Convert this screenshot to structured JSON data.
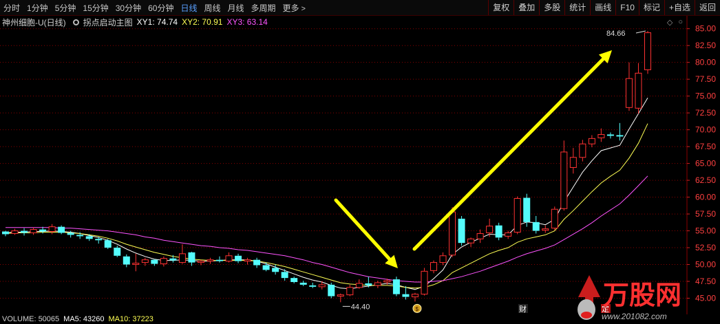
{
  "toolbar": {
    "periods": [
      "分时",
      "1分钟",
      "5分钟",
      "15分钟",
      "30分钟",
      "60分钟",
      "日线",
      "周线",
      "月线",
      "多周期",
      "更多"
    ],
    "active_period": "日线",
    "tools": [
      "复权",
      "叠加",
      "多股",
      "统计",
      "画线",
      "F10",
      "标记",
      "+自选",
      "返回"
    ]
  },
  "info": {
    "stock": "神州细胞-U(日线)",
    "indicator": "拐点启动主图",
    "xy1": "XY1: 74.74",
    "xy2": "XY2: 70.91",
    "xy3": "XY3: 63.14"
  },
  "volume": {
    "vol": "VOLUME: 50065",
    "ma5": "MA5: 43260",
    "ma10": "MA10: 37223"
  },
  "markers": {
    "cai": "财",
    "ding": "定"
  },
  "watermark": {
    "brand": "万股网",
    "url": "www.201082.com"
  },
  "chart_data": {
    "type": "candlestick",
    "y_ticks": [
      "85.00",
      "82.50",
      "80.00",
      "77.50",
      "75.00",
      "72.50",
      "70.00",
      "67.50",
      "65.00",
      "62.50",
      "60.00",
      "57.50",
      "55.00",
      "52.50",
      "50.00",
      "47.50",
      "45.00"
    ],
    "ylim": [
      43.5,
      85.5
    ],
    "high_label": "84.66",
    "low_label": "44.40",
    "grid": true,
    "colors": {
      "up": "#ff3232",
      "down": "#54fcfc",
      "line_xy1": "#ffffff",
      "line_xy2": "#ffff54",
      "line_xy3": "#ff54ff",
      "arrow": "#ffff00",
      "grid": "#8b0000",
      "axis_text": "#ff4040"
    },
    "candles": [
      [
        54.9,
        55.0,
        54.2,
        54.5
      ],
      [
        54.6,
        55.3,
        54.4,
        55.0
      ],
      [
        55.0,
        55.4,
        54.3,
        54.7
      ],
      [
        54.7,
        55.5,
        54.4,
        55.2
      ],
      [
        55.2,
        55.6,
        54.6,
        54.9
      ],
      [
        54.9,
        56.0,
        54.5,
        55.6
      ],
      [
        55.6,
        55.8,
        54.5,
        54.7
      ],
      [
        54.7,
        55.0,
        54.0,
        54.4
      ],
      [
        54.4,
        54.8,
        53.8,
        54.2
      ],
      [
        54.2,
        54.5,
        53.5,
        53.8
      ],
      [
        53.8,
        54.1,
        53.1,
        53.6
      ],
      [
        53.6,
        53.8,
        52.3,
        52.5
      ],
      [
        52.5,
        52.8,
        51.1,
        51.3
      ],
      [
        51.2,
        51.5,
        49.6,
        50.0
      ],
      [
        50.0,
        51.6,
        49.0,
        50.2
      ],
      [
        50.3,
        51.0,
        49.8,
        50.7
      ],
      [
        50.7,
        50.8,
        49.8,
        50.1
      ],
      [
        50.1,
        51.2,
        49.7,
        50.9
      ],
      [
        50.9,
        51.4,
        50.3,
        50.6
      ],
      [
        50.3,
        53.0,
        50.1,
        51.6
      ],
      [
        51.8,
        51.9,
        49.8,
        50.3
      ],
      [
        50.3,
        50.7,
        49.9,
        50.5
      ],
      [
        50.5,
        51.0,
        50.1,
        50.7
      ],
      [
        50.7,
        51.2,
        50.3,
        50.5
      ],
      [
        50.5,
        51.8,
        50.3,
        51.3
      ],
      [
        51.3,
        51.6,
        50.2,
        50.5
      ],
      [
        50.5,
        51.0,
        50.0,
        50.7
      ],
      [
        50.7,
        51.0,
        49.5,
        49.9
      ],
      [
        49.9,
        50.3,
        49.0,
        49.2
      ],
      [
        49.5,
        50.0,
        48.5,
        48.9
      ],
      [
        48.9,
        49.3,
        47.6,
        48.0
      ],
      [
        48.0,
        48.2,
        47.2,
        47.4
      ],
      [
        47.3,
        47.6,
        46.8,
        47.0
      ],
      [
        46.9,
        47.3,
        46.5,
        46.7
      ],
      [
        46.7,
        47.5,
        46.3,
        47.0
      ],
      [
        47.0,
        47.3,
        45.0,
        45.3
      ],
      [
        45.3,
        45.7,
        44.4,
        45.5
      ],
      [
        45.5,
        47.0,
        45.3,
        46.6
      ],
      [
        46.6,
        47.8,
        46.4,
        47.2
      ],
      [
        47.2,
        48.2,
        46.6,
        46.9
      ],
      [
        46.9,
        47.6,
        46.5,
        47.3
      ],
      [
        47.4,
        47.9,
        47.0,
        47.6
      ],
      [
        47.8,
        48.2,
        45.3,
        45.6
      ],
      [
        45.6,
        46.8,
        44.8,
        45.2
      ],
      [
        45.2,
        45.8,
        44.5,
        45.6
      ],
      [
        45.6,
        49.5,
        45.4,
        49.0
      ],
      [
        49.1,
        50.6,
        48.7,
        50.3
      ],
      [
        50.3,
        51.8,
        49.9,
        51.3
      ],
      [
        51.4,
        58.5,
        51.1,
        57.8
      ],
      [
        56.8,
        57.2,
        52.8,
        53.2
      ],
      [
        53.2,
        54.0,
        52.6,
        53.8
      ],
      [
        53.8,
        55.2,
        53.2,
        54.6
      ],
      [
        54.7,
        56.8,
        54.1,
        55.7
      ],
      [
        55.8,
        56.2,
        53.6,
        54.0
      ],
      [
        54.2,
        55.0,
        53.8,
        54.7
      ],
      [
        54.8,
        60.1,
        54.5,
        59.8
      ],
      [
        59.9,
        60.5,
        55.6,
        56.3
      ],
      [
        56.3,
        57.2,
        54.6,
        55.0
      ],
      [
        55.1,
        55.8,
        54.7,
        55.3
      ],
      [
        55.4,
        58.6,
        55.1,
        58.2
      ],
      [
        58.3,
        68.4,
        58.0,
        66.7
      ],
      [
        64.4,
        67.3,
        63.5,
        65.9
      ],
      [
        65.9,
        68.5,
        65.3,
        67.9
      ],
      [
        67.9,
        69.2,
        67.4,
        68.7
      ],
      [
        68.8,
        70.2,
        68.2,
        69.3
      ],
      [
        69.3,
        69.6,
        68.7,
        69.1
      ],
      [
        69.2,
        71.0,
        68.4,
        69.0
      ],
      [
        73.3,
        80.0,
        72.8,
        77.6
      ],
      [
        73.2,
        79.9,
        72.4,
        78.4
      ],
      [
        78.9,
        84.66,
        78.3,
        84.4
      ]
    ],
    "series": [
      {
        "name": "XY1",
        "values": [
          54.7,
          54.8,
          54.8,
          54.9,
          54.9,
          55.0,
          54.9,
          54.8,
          54.6,
          54.3,
          54.0,
          53.6,
          53.0,
          52.3,
          51.7,
          51.2,
          50.8,
          50.6,
          50.6,
          50.7,
          50.6,
          50.5,
          50.5,
          50.6,
          50.7,
          50.7,
          50.7,
          50.5,
          50.1,
          49.6,
          49.1,
          48.6,
          48.1,
          47.7,
          47.4,
          46.9,
          46.5,
          46.4,
          46.6,
          46.8,
          47.0,
          47.2,
          47.0,
          46.6,
          46.3,
          46.8,
          47.9,
          49.2,
          51.5,
          52.6,
          53.3,
          53.9,
          54.5,
          54.4,
          54.4,
          55.8,
          56.3,
          56.2,
          55.9,
          56.7,
          59.3,
          61.5,
          63.7,
          65.4,
          66.9,
          67.3,
          67.7,
          70.1,
          72.4,
          74.74
        ]
      },
      {
        "name": "XY2",
        "values": [
          54.6,
          54.7,
          54.7,
          54.7,
          54.8,
          54.8,
          54.8,
          54.7,
          54.6,
          54.4,
          54.2,
          53.9,
          53.5,
          53.0,
          52.6,
          52.2,
          51.8,
          51.5,
          51.2,
          51.0,
          50.8,
          50.7,
          50.6,
          50.6,
          50.6,
          50.6,
          50.6,
          50.5,
          50.3,
          50.0,
          49.7,
          49.3,
          48.9,
          48.5,
          48.1,
          47.7,
          47.3,
          47.1,
          47.0,
          46.9,
          46.9,
          46.9,
          46.8,
          46.6,
          46.5,
          46.6,
          47.0,
          47.6,
          48.8,
          49.5,
          50.2,
          50.9,
          51.6,
          52.1,
          52.5,
          53.3,
          53.8,
          54.1,
          54.4,
          55.0,
          56.7,
          58.0,
          59.4,
          60.8,
          62.1,
          63.1,
          64.0,
          65.8,
          68.0,
          70.91
        ]
      },
      {
        "name": "XY3",
        "values": [
          55.5,
          55.5,
          55.5,
          55.5,
          55.5,
          55.5,
          55.4,
          55.4,
          55.3,
          55.2,
          55.1,
          55.0,
          54.8,
          54.6,
          54.4,
          54.1,
          53.9,
          53.6,
          53.4,
          53.2,
          53.0,
          52.8,
          52.7,
          52.5,
          52.4,
          52.2,
          52.1,
          51.9,
          51.7,
          51.5,
          51.3,
          51.0,
          50.7,
          50.3,
          50.0,
          49.6,
          49.2,
          48.8,
          48.5,
          48.2,
          48.0,
          47.8,
          47.6,
          47.5,
          47.4,
          47.4,
          47.5,
          47.6,
          47.9,
          48.2,
          48.6,
          49.0,
          49.5,
          50.0,
          50.5,
          51.1,
          51.6,
          52.0,
          52.4,
          52.9,
          53.7,
          54.5,
          55.3,
          56.2,
          57.2,
          58.1,
          59.0,
          60.3,
          61.7,
          63.14
        ]
      }
    ]
  }
}
